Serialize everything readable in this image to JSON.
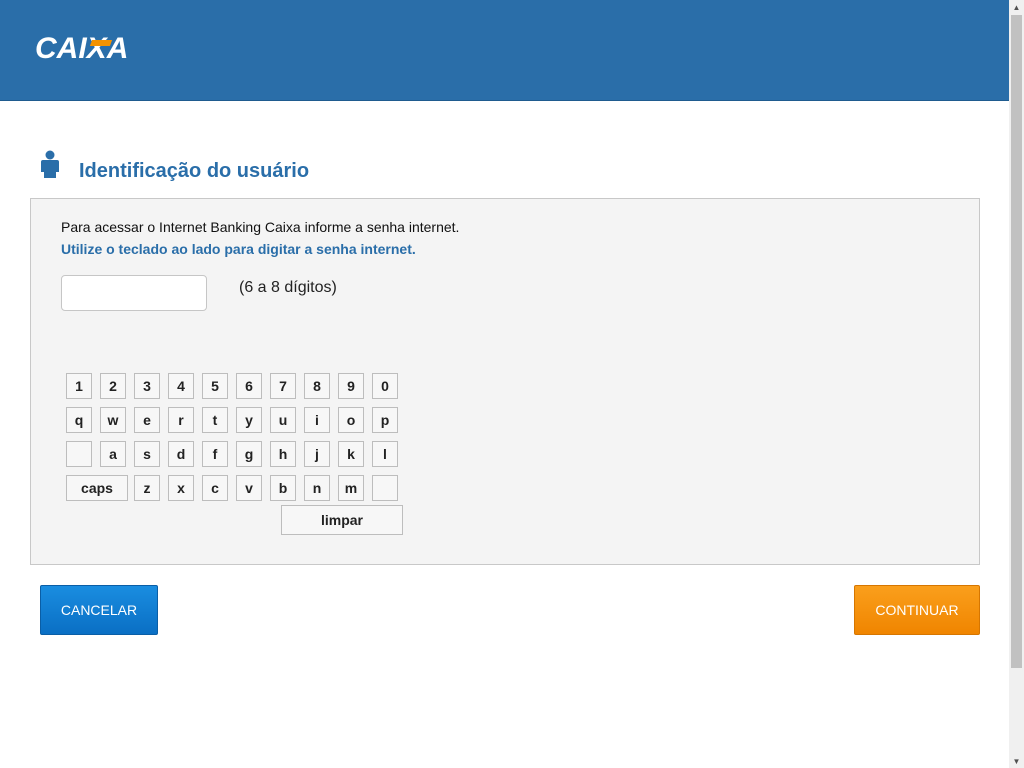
{
  "header": {
    "logo_text": "CAIXA",
    "bg_color": "#2a6ea9",
    "accent_color": "#f39200"
  },
  "title": {
    "icon": "user-icon",
    "text": "Identificação do usuário"
  },
  "form": {
    "instruction": "Para acessar o Internet Banking Caixa informe a senha internet.",
    "keyboard_instruction": "Utilize o teclado ao lado para digitar a senha internet.",
    "password_value": "",
    "password_hint": "(6 a 8 dígitos)"
  },
  "keyboard": {
    "row1": [
      "1",
      "2",
      "3",
      "4",
      "5",
      "6",
      "7",
      "8",
      "9",
      "0"
    ],
    "row2": [
      "q",
      "w",
      "e",
      "r",
      "t",
      "y",
      "u",
      "i",
      "o",
      "p"
    ],
    "row3": [
      "",
      "a",
      "s",
      "d",
      "f",
      "g",
      "h",
      "j",
      "k",
      "l"
    ],
    "row4": [
      "caps",
      "z",
      "x",
      "c",
      "v",
      "b",
      "n",
      "m",
      ""
    ],
    "clear_label": "limpar"
  },
  "buttons": {
    "cancel_label": "CANCELAR",
    "continue_label": "CONTINUAR"
  }
}
